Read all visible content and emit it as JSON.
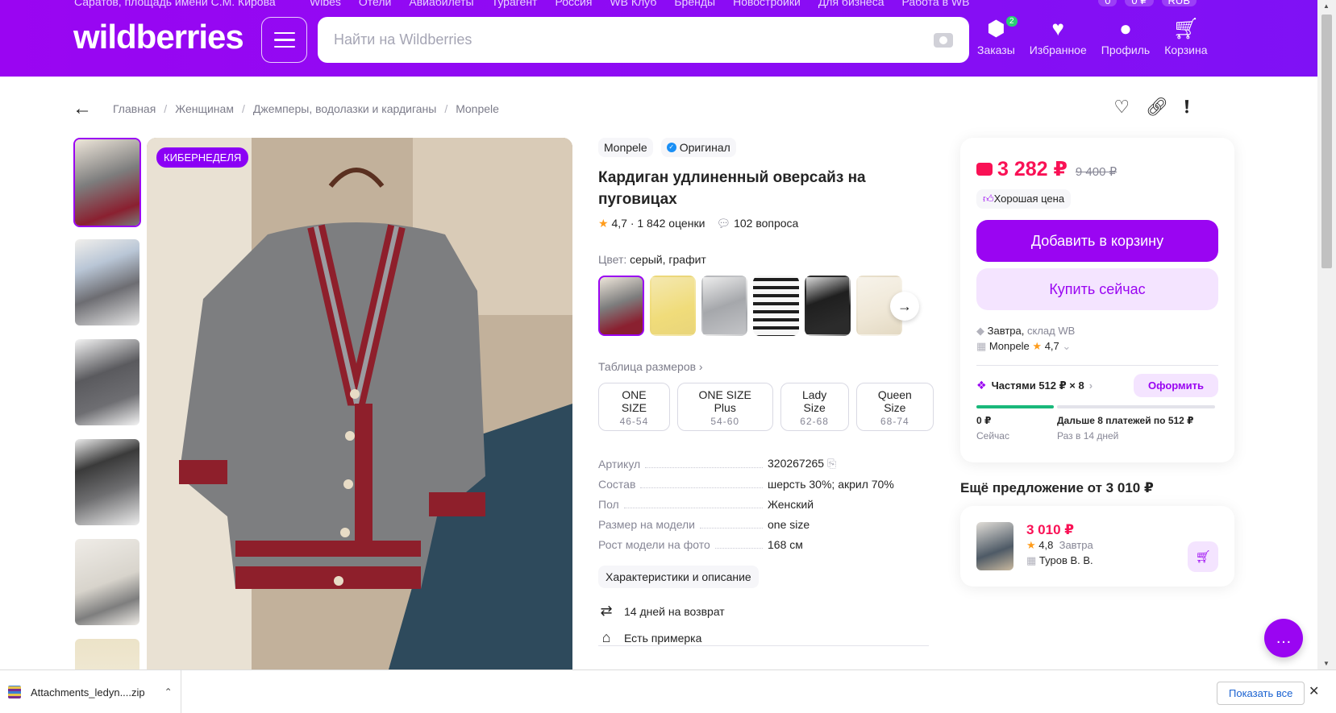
{
  "header": {
    "location": "Саратов, площадь имени С.М. Кирова",
    "top_links": [
      "Wibes",
      "Отели",
      "Авиабилеты",
      "Турагент",
      "Россия",
      "WB Клуб",
      "Бренды",
      "Новостройки",
      "Для бизнеса",
      "Работа в WB"
    ],
    "top_right": [
      "0",
      "0 ₽",
      "RUB"
    ],
    "logo": "wildberries",
    "search_placeholder": "Найти на Wildberries",
    "nav": [
      {
        "label": "Заказы",
        "icon": "box-icon",
        "badge": "2"
      },
      {
        "label": "Избранное",
        "icon": "heart-icon"
      },
      {
        "label": "Профиль",
        "icon": "user-icon"
      },
      {
        "label": "Корзина",
        "icon": "cart-icon"
      }
    ]
  },
  "breadcrumbs": [
    "Главная",
    "Женщинам",
    "Джемперы, водолазки и кардиганы",
    "Monpele"
  ],
  "promo_label": "КИБЕРНЕДЕЛЯ",
  "product": {
    "brand": "Monpele",
    "original_label": "Оригинал",
    "title": "Кардиган удлиненный оверсайз на пуговицах",
    "rating": "4,7",
    "ratings_count": "· 1 842 оценки",
    "questions": "102 вопроса",
    "color_label": "Цвет:",
    "color_value": "серый, графит",
    "size_table": "Таблица размеров",
    "sizes": [
      {
        "name": "ONE SIZE",
        "range": "46-54"
      },
      {
        "name": "ONE SIZE Plus",
        "range": "54-60"
      },
      {
        "name": "Lady Size",
        "range": "62-68"
      },
      {
        "name": "Queen Size",
        "range": "68-74"
      }
    ],
    "specs": [
      {
        "k": "Артикул",
        "v": "320267265"
      },
      {
        "k": "Состав",
        "v": "шерсть 30%; акрил 70%"
      },
      {
        "k": "Пол",
        "v": "Женский"
      },
      {
        "k": "Размер на модели",
        "v": "one size"
      },
      {
        "k": "Рост модели на фото",
        "v": "168 см"
      }
    ],
    "char_button": "Характеристики и описание",
    "return_text": "14 дней на возврат",
    "fitting_text": "Есть примерка"
  },
  "price_card": {
    "price": "3 282 ₽",
    "old_price": "9 400 ₽",
    "good_price": "Хорошая цена",
    "add_to_cart": "Добавить в корзину",
    "buy_now": "Купить сейчас",
    "delivery_when": "Завтра,",
    "delivery_where": "склад WB",
    "seller": "Monpele",
    "seller_rating": "4,7",
    "parts_label": "Частями 512 ₽ × 8",
    "apply_button": "Оформить",
    "pay_now_amount": "0 ₽",
    "pay_now_label": "Сейчас",
    "pay_later_amount": "Дальше 8 платежей по 512 ₽",
    "pay_later_label": "Раз в 14 дней"
  },
  "more_offers": {
    "title": "Ещё предложение от 3 010 ₽",
    "price": "3 010 ₽",
    "rating": "4,8",
    "delivery": "Завтра",
    "seller": "Туров В. В."
  },
  "downloads": {
    "file": "Attachments_ledyn....zip",
    "show_all": "Показать все"
  },
  "colors": {
    "accent": "#9a05f2",
    "price": "#f91155",
    "header_bg": "#8b00f5"
  }
}
